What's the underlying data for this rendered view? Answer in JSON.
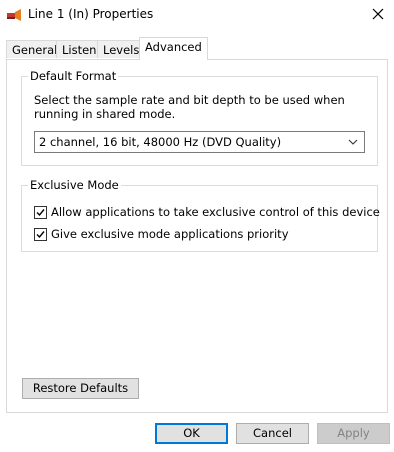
{
  "window": {
    "title": "Line 1 (In) Properties",
    "icon": "speaker-icon",
    "close_glyph": "✕"
  },
  "tabs": [
    {
      "label": "General",
      "active": false
    },
    {
      "label": "Listen",
      "active": false
    },
    {
      "label": "Levels",
      "active": false
    },
    {
      "label": "Advanced",
      "active": true
    }
  ],
  "default_format": {
    "legend": "Default Format",
    "description": "Select the sample rate and bit depth to be used when running in shared mode.",
    "selected_format": "2 channel, 16 bit, 48000 Hz (DVD Quality)"
  },
  "exclusive_mode": {
    "legend": "Exclusive Mode",
    "options": [
      {
        "label": "Allow applications to take exclusive control of this device",
        "checked": true
      },
      {
        "label": "Give exclusive mode applications priority",
        "checked": true
      }
    ]
  },
  "restore_defaults_label": "Restore Defaults",
  "buttons": {
    "ok": "OK",
    "cancel": "Cancel",
    "apply": "Apply"
  },
  "colors": {
    "accent": "#0078d7",
    "button_face": "#e1e1e1",
    "disabled_text": "#838383"
  }
}
